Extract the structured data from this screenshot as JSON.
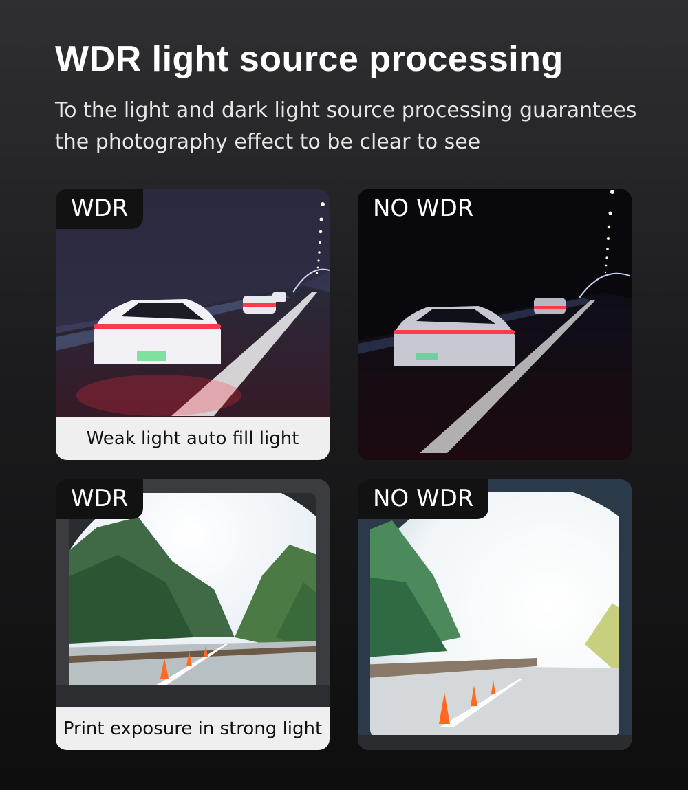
{
  "header": {
    "title": "WDR light source processing",
    "subtitle": "To the light and dark light source processing guarantees the photography effect to be clear to see"
  },
  "panels": [
    {
      "tag": "WDR",
      "caption": "Weak light auto fill light",
      "scene": "night-tunnel-bright"
    },
    {
      "tag": "NO WDR",
      "caption": "",
      "scene": "night-tunnel-dark"
    },
    {
      "tag": "WDR",
      "caption": "Print exposure in strong light",
      "scene": "tunnel-exit-balanced"
    },
    {
      "tag": "NO WDR",
      "caption": "",
      "scene": "tunnel-exit-overexposed"
    }
  ],
  "colors": {
    "background_top": "#2f2f31",
    "background_bottom": "#0e0e0f",
    "tag_bg": "#121212",
    "caption_bg": "#efefef",
    "brake_light": "#ff3a4a"
  }
}
